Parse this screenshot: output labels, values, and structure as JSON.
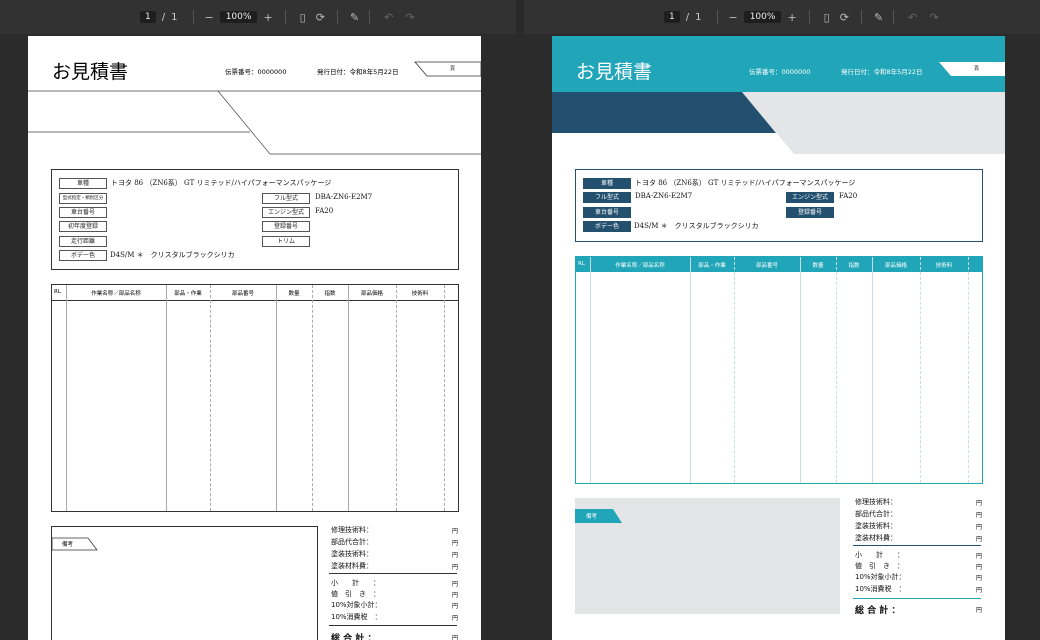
{
  "toolbar": {
    "page_current": "1",
    "page_sep": "/",
    "page_total": "1",
    "zoom": "100%",
    "zoom_out": "−",
    "zoom_in": "+",
    "undo": "↶",
    "redo": "↷"
  },
  "doc": {
    "title": "お見積書",
    "slip_no": "伝票番号：0000000",
    "issue_date": "発行日付：令和8年5月22日",
    "stamp": "頁",
    "vehicle": {
      "model_label": "車種",
      "model_value": "トヨタ 86 （ZN6系） GT リミテッド/ハイパフォーマンスパッケージ",
      "type_spec_label": "型式指定・類別区分",
      "full_type_label": "フル型式",
      "full_type_value": "DBA-ZN6-E2M7",
      "chassis_label": "車台番号",
      "engine_label": "エンジン型式",
      "engine_value": "FA20",
      "first_reg_label": "初年度登録",
      "reg_no_label": "登録番号",
      "mileage_label": "走行距離",
      "trim_label": "トリム",
      "body_color_label": "ボデー色",
      "body_color_value": "D4S/M ＊　クリスタルブラックシリカ"
    },
    "table_headers": [
      "RL",
      "作業名称／部品名称",
      "部品・作業",
      "部品番号",
      "数量",
      "指数",
      "部品価格",
      "技術料"
    ],
    "remarks_label": "備考",
    "summary": [
      {
        "label": "修理技術料：",
        "unit": "円"
      },
      {
        "label": "部品代合計：",
        "unit": "円"
      },
      {
        "label": "塗装技術料：",
        "unit": "円"
      },
      {
        "label": "塗装材料費：",
        "unit": "円"
      },
      {
        "label": "小　　計　　：",
        "unit": "円"
      },
      {
        "label": "値　引　き　：",
        "unit": "円"
      },
      {
        "label": "10%対象小計：",
        "unit": "円"
      },
      {
        "label": "10%消費税　：",
        "unit": "円"
      }
    ],
    "total_label": "総 合 計 ：",
    "total_unit": "円"
  },
  "colors": {
    "teal": "#20a6b8",
    "navy": "#22506e",
    "gray": "#e4e5e7"
  }
}
